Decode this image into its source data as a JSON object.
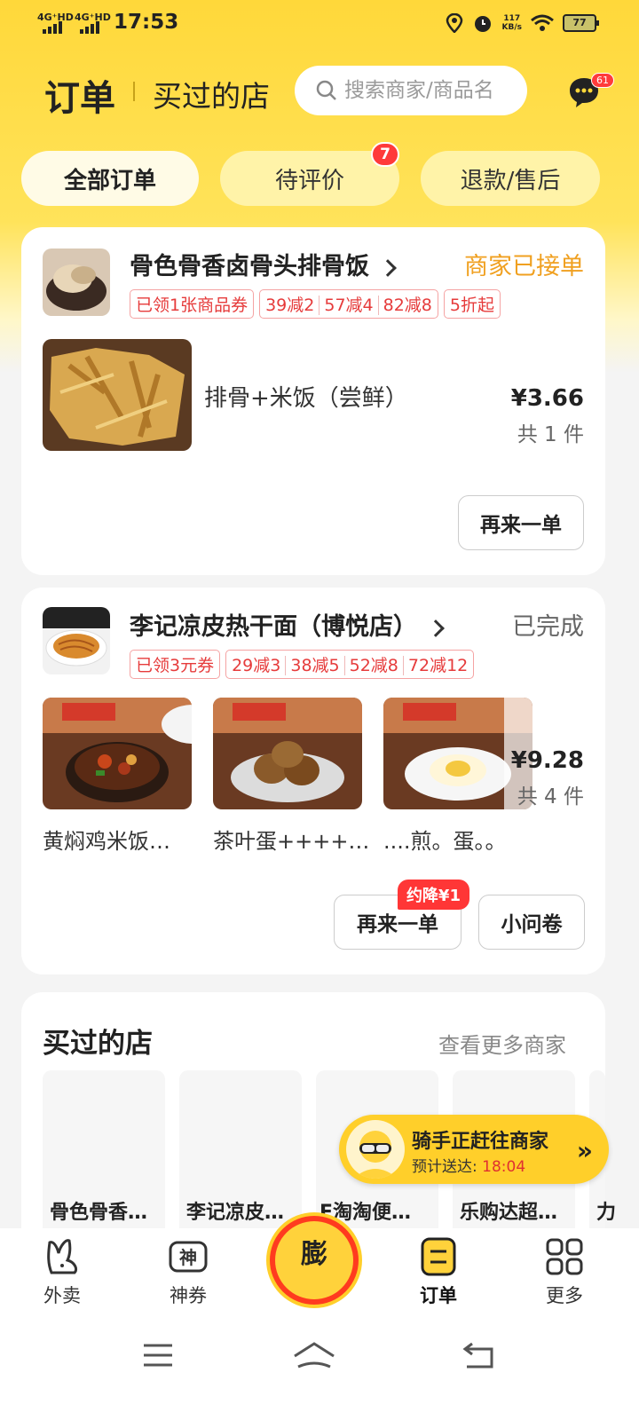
{
  "status_bar": {
    "net1": "4G⁺HD",
    "net2": "4G⁺HD",
    "time": "17:53",
    "speed": "117",
    "speed_unit": "KB/s",
    "battery": "77"
  },
  "header": {
    "title": "订单",
    "bought_tab": "买过的店",
    "search_placeholder": "搜索商家/商品名",
    "message_badge": "61"
  },
  "tabs": [
    {
      "label": "全部订单",
      "active": true
    },
    {
      "label": "待评价",
      "badge": "7"
    },
    {
      "label": "退款/售后"
    }
  ],
  "orders": [
    {
      "shop": "骨色骨香卤骨头排骨饭",
      "status": "商家已接单",
      "status_color": "#f0a020",
      "coupon": "已领1张商品券",
      "discounts": [
        "39减2",
        "57减4",
        "82减8"
      ],
      "extra_tag": "5折起",
      "item_name": "排骨+米饭（尝鲜）",
      "price": "¥3.66",
      "count": "共 1 件",
      "reorder_label": "再来一单"
    },
    {
      "shop": "李记凉皮热干面（博悦店）",
      "status": "已完成",
      "status_color": "#666666",
      "coupon": "已领3元券",
      "discounts": [
        "29减3",
        "38减5",
        "52减8",
        "72减12"
      ],
      "items": [
        "黄焖鸡米饭…",
        "茶叶蛋++++…",
        "....煎。蛋。。"
      ],
      "price": "¥9.28",
      "count": "共 4 件",
      "reorder_label": "再来一单",
      "reorder_badge": "约降¥1",
      "survey_label": "小问卷"
    }
  ],
  "bought_stores": {
    "title": "买过的店",
    "more": "查看更多商家",
    "stores": [
      "骨色骨香…",
      "李记凉皮…",
      "E淘淘便…",
      "乐购达超…",
      "力"
    ]
  },
  "rider": {
    "title": "骑手正赶往商家",
    "eta_label": "预计送达:",
    "eta_time": "18:04"
  },
  "bottom_nav": [
    {
      "label": "外卖",
      "icon": "rabbit-icon"
    },
    {
      "label": "神券",
      "icon": "coupon-icon"
    },
    {
      "label": "膨",
      "icon": "center-promo-icon"
    },
    {
      "label": "订单",
      "icon": "order-icon",
      "active": true
    },
    {
      "label": "更多",
      "icon": "grid-icon"
    }
  ],
  "colors": {
    "brand_yellow": "#ffd83a",
    "accent_red": "#ff3a3a"
  }
}
